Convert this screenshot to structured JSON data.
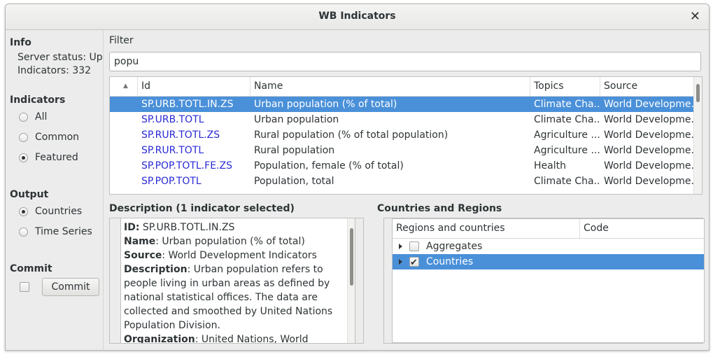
{
  "window": {
    "title": "WB Indicators"
  },
  "sidebar": {
    "info": {
      "title": "Info",
      "server_status": "Server status: Up",
      "indicators": "Indicators: 332"
    },
    "indicators": {
      "title": "Indicators",
      "options": [
        "All",
        "Common",
        "Featured"
      ],
      "selected": "Featured"
    },
    "output": {
      "title": "Output",
      "options": [
        "Countries",
        "Time Series"
      ],
      "selected": "Countries"
    },
    "commit": {
      "title": "Commit",
      "button": "Commit",
      "auto_checked": false
    }
  },
  "filter": {
    "label": "Filter",
    "value": "popu"
  },
  "indicators_table": {
    "headers": {
      "id": "Id",
      "name": "Name",
      "topics": "Topics",
      "source": "Source"
    },
    "sort_indicator": "up-arrow-icon",
    "rows": [
      {
        "id": "SP.URB.TOTL.IN.ZS",
        "name": "Urban population (% of total)",
        "topics": "Climate Cha...",
        "source": "World Developme...",
        "selected": true
      },
      {
        "id": "SP.URB.TOTL",
        "name": "Urban population",
        "topics": "Climate Cha...",
        "source": "World Developme...",
        "selected": false
      },
      {
        "id": "SP.RUR.TOTL.ZS",
        "name": "Rural population (% of total population)",
        "topics": "Agriculture ...",
        "source": "World Developme...",
        "selected": false
      },
      {
        "id": "SP.RUR.TOTL",
        "name": "Rural population",
        "topics": "Agriculture ...",
        "source": "World Developme...",
        "selected": false
      },
      {
        "id": "SP.POP.TOTL.FE.ZS",
        "name": "Population, female (% of total)",
        "topics": "Health",
        "source": "World Developme...",
        "selected": false
      },
      {
        "id": "SP.POP.TOTL",
        "name": "Population, total",
        "topics": "Climate Cha...",
        "source": "World Developme...",
        "selected": false
      }
    ]
  },
  "description": {
    "title": "Description (1 indicator selected)",
    "id_label": "ID:",
    "id_value": " SP.URB.TOTL.IN.ZS",
    "name_label": "Name",
    "name_value": ": Urban population (% of total)",
    "source_label": "Source",
    "source_value": ": World Development Indicators",
    "desc_label": "Description",
    "desc_value": ": Urban population refers to people living in urban areas as defined by national statistical offices. The data are collected and smoothed by United Nations Population Division.",
    "org_label": "Organization",
    "org_value": ": United Nations, World Urbanization Prospects."
  },
  "countries": {
    "title": "Countries and Regions",
    "headers": {
      "regions": "Regions and countries",
      "code": "Code"
    },
    "items": [
      {
        "label": "Aggregates",
        "checked": false,
        "selected": false
      },
      {
        "label": "Countries",
        "checked": true,
        "selected": true
      }
    ]
  },
  "colors": {
    "selection": "#4a90d9",
    "link": "#2a2ad6",
    "background": "#ececec"
  }
}
